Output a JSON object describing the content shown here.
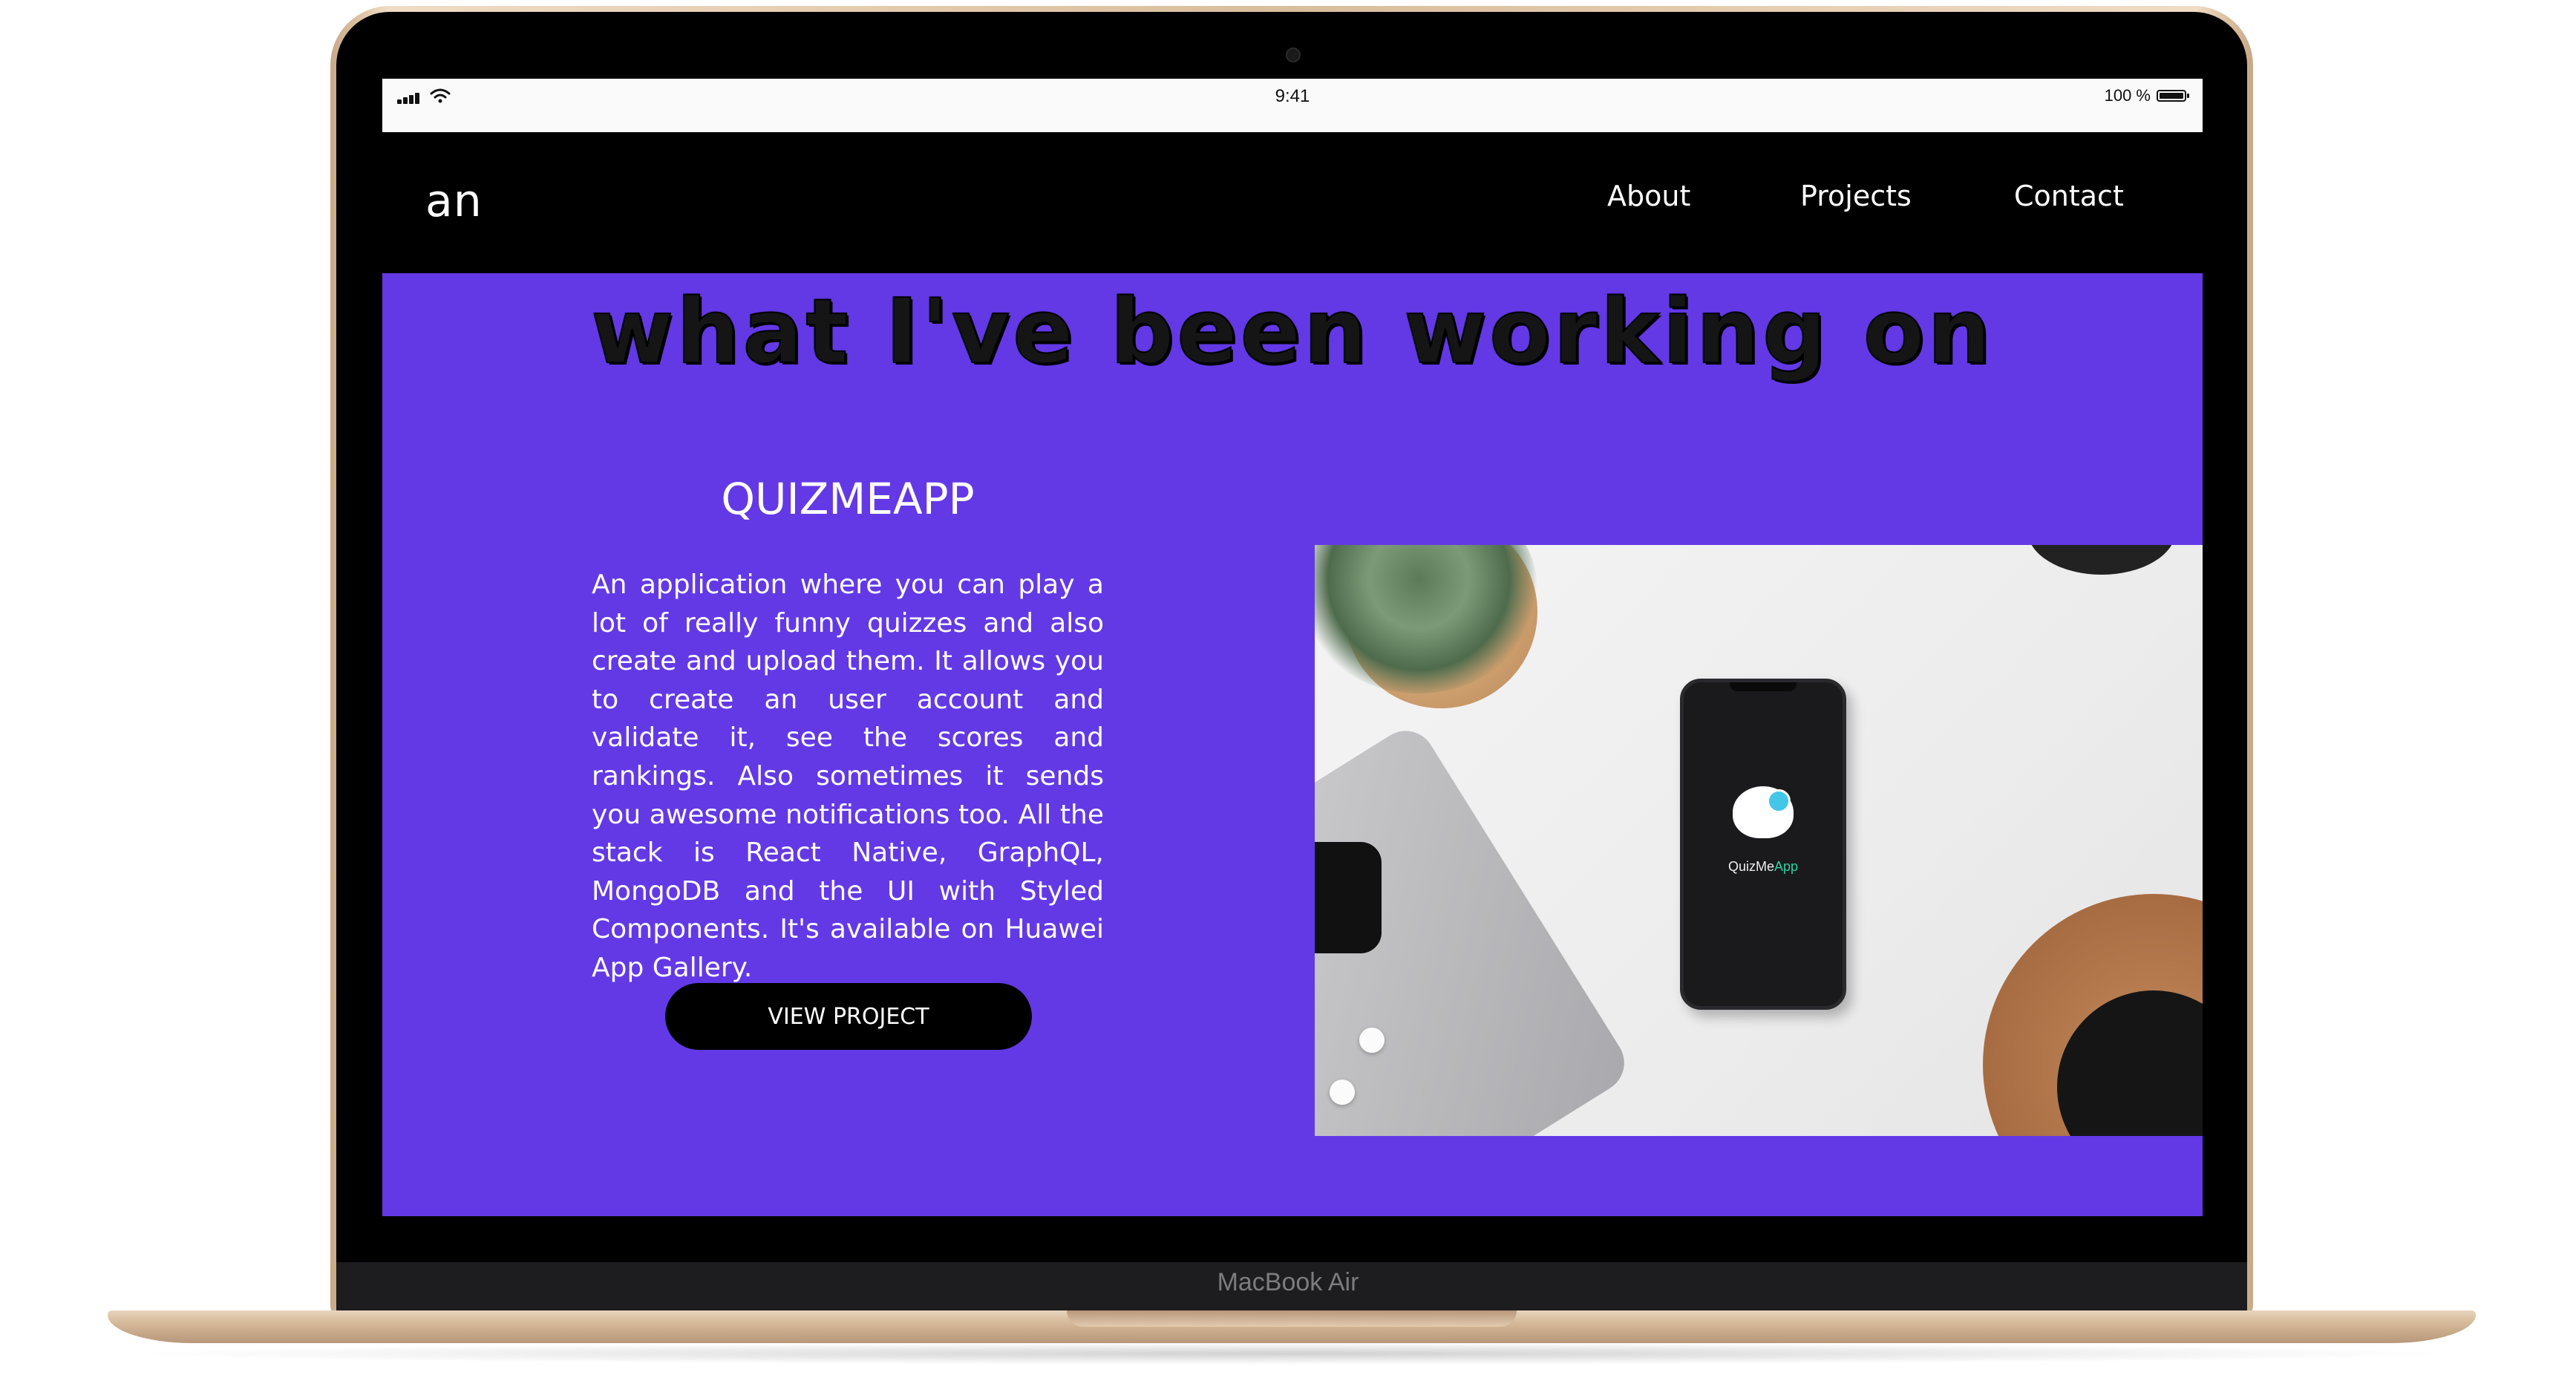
{
  "device": {
    "label": "MacBook Air"
  },
  "statusbar": {
    "time": "9:41",
    "battery": "100 %"
  },
  "nav": {
    "logo": "an",
    "links": [
      "About",
      "Projects",
      "Contact"
    ]
  },
  "section": {
    "title": "what I've been working on"
  },
  "project": {
    "title": "QUIZMEAPP",
    "description": "An application where you can play a lot of really funny quizzes and also create and upload them. It allows you to create an user account and validate it, see the scores and rankings. Also sometimes it sends you awesome notifications too. All the stack is React Native, GraphQL, MongoDB and the UI with Styled Components. It's available on Huawei App Gallery.",
    "button": "VIEW PROJECT",
    "image": {
      "app_name_prefix": "QuizMe",
      "app_name_accent": "App"
    }
  },
  "colors": {
    "accent": "#6339e6",
    "button": "#000000",
    "app_accent": "#2ed2a0"
  }
}
